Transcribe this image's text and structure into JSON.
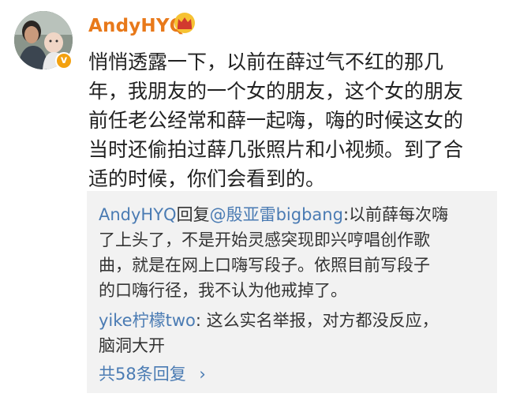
{
  "author": {
    "username": "AndyHYQ",
    "badge_text": "v",
    "colors": {
      "username": "#e8791a",
      "crown": "#f3a10f",
      "badge": "#f3a10f"
    }
  },
  "post": {
    "lines": [
      "悄悄透露一下，以前在薛过气不红的那几",
      "年，我朋友的一个女的朋友，这个女的朋友",
      "前任老公经常和薛一起嗨，嗨的时候这女的",
      "当时还偷拍过薛几张照片和小视频。到了合",
      "适的时候，你们会看到的。"
    ]
  },
  "replies": [
    {
      "user": "AndyHYQ",
      "reply_word": "回复",
      "mention": "@殷亚雷bigbang",
      "lines": [
        ":以前薛每次嗨",
        "了上头了，不是开始灵感突现即兴哼唱创作歌",
        "曲，就是在网上口嗨写段子。依照目前写段子",
        "的口嗨行径，我不认为他戒掉了。"
      ]
    },
    {
      "user": "yike柠檬two",
      "lines": [
        ": 这么实名举报，对方都没反应，",
        "脑洞大开"
      ]
    }
  ],
  "more_replies": {
    "label": "共58条回复",
    "chevron": "›"
  },
  "colors": {
    "link": "#4a7bb3",
    "reply_bg": "#f2f2f2",
    "text": "#222222"
  }
}
